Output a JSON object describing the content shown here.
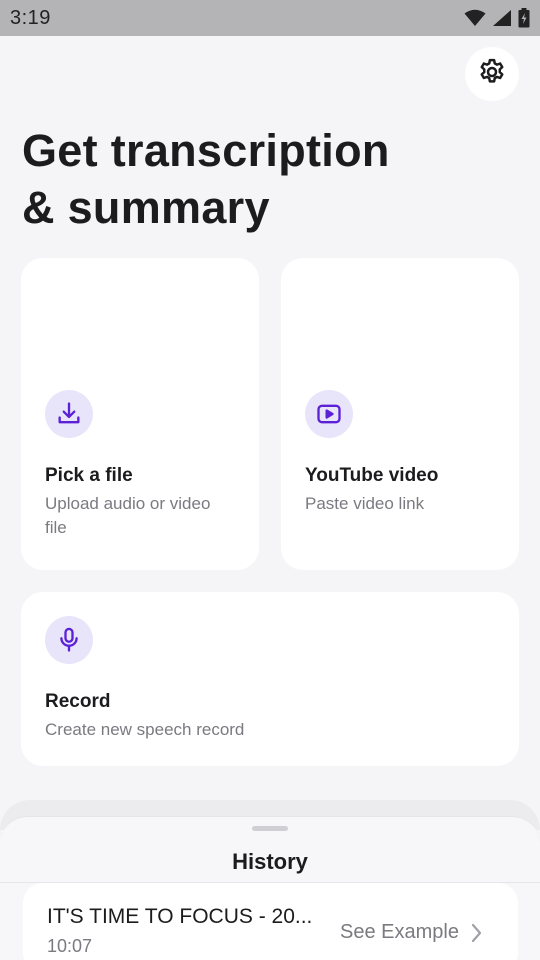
{
  "status_bar": {
    "time": "3:19",
    "icons": [
      "wifi-icon",
      "signal-icon",
      "battery-icon"
    ]
  },
  "header": {
    "settings_icon": "gear-icon",
    "title_line1": "Get transcription",
    "title_line2": "& summary"
  },
  "actions": {
    "pick_file": {
      "icon": "download-icon",
      "title": "Pick a file",
      "subtitle_line1": "Upload audio or video",
      "subtitle_line2": "file"
    },
    "youtube": {
      "icon": "play-icon",
      "title": "YouTube video",
      "subtitle": "Paste video link"
    },
    "record": {
      "icon": "microphone-icon",
      "title": "Record",
      "subtitle": "Create new speech record"
    }
  },
  "history": {
    "title": "History",
    "items": [
      {
        "title": "IT'S TIME TO FOCUS - 20...",
        "time": "10:07",
        "action": "See Example"
      }
    ]
  },
  "colors": {
    "accent": "#5b21d6",
    "icon_bg": "#e8e4fa",
    "background": "#f5f5f8",
    "card": "#ffffff"
  }
}
